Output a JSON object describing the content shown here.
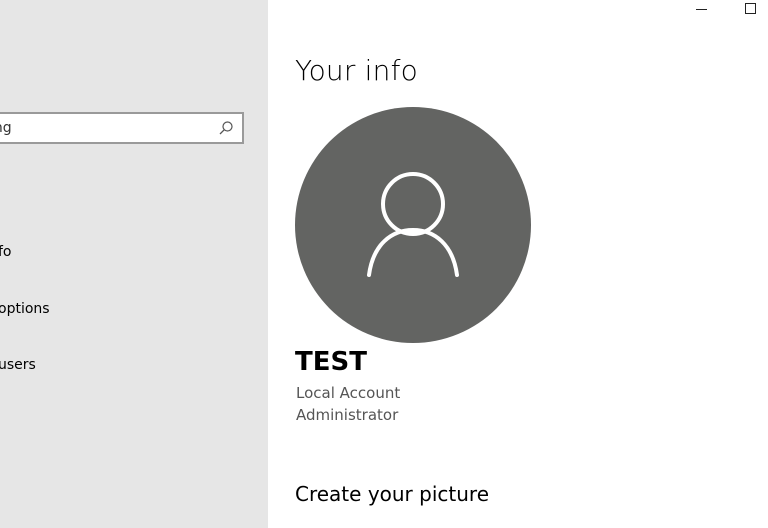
{
  "search": {
    "value": "ing"
  },
  "sidebar": {
    "items": [
      {
        "label": "fo"
      },
      {
        "label": " options"
      },
      {
        "label": "users"
      }
    ]
  },
  "main": {
    "title": "Your info",
    "user_name": "TEST",
    "account_type": "Local Account",
    "account_role": "Administrator",
    "section_heading": "Create your picture"
  },
  "icons": {
    "search": "search-icon",
    "avatar": "person-icon",
    "minimize": "minimize-icon",
    "maximize": "maximize-icon"
  },
  "colors": {
    "sidebar_bg": "#e6e6e6",
    "avatar_bg": "#636462",
    "search_border": "#9a9a9a"
  }
}
